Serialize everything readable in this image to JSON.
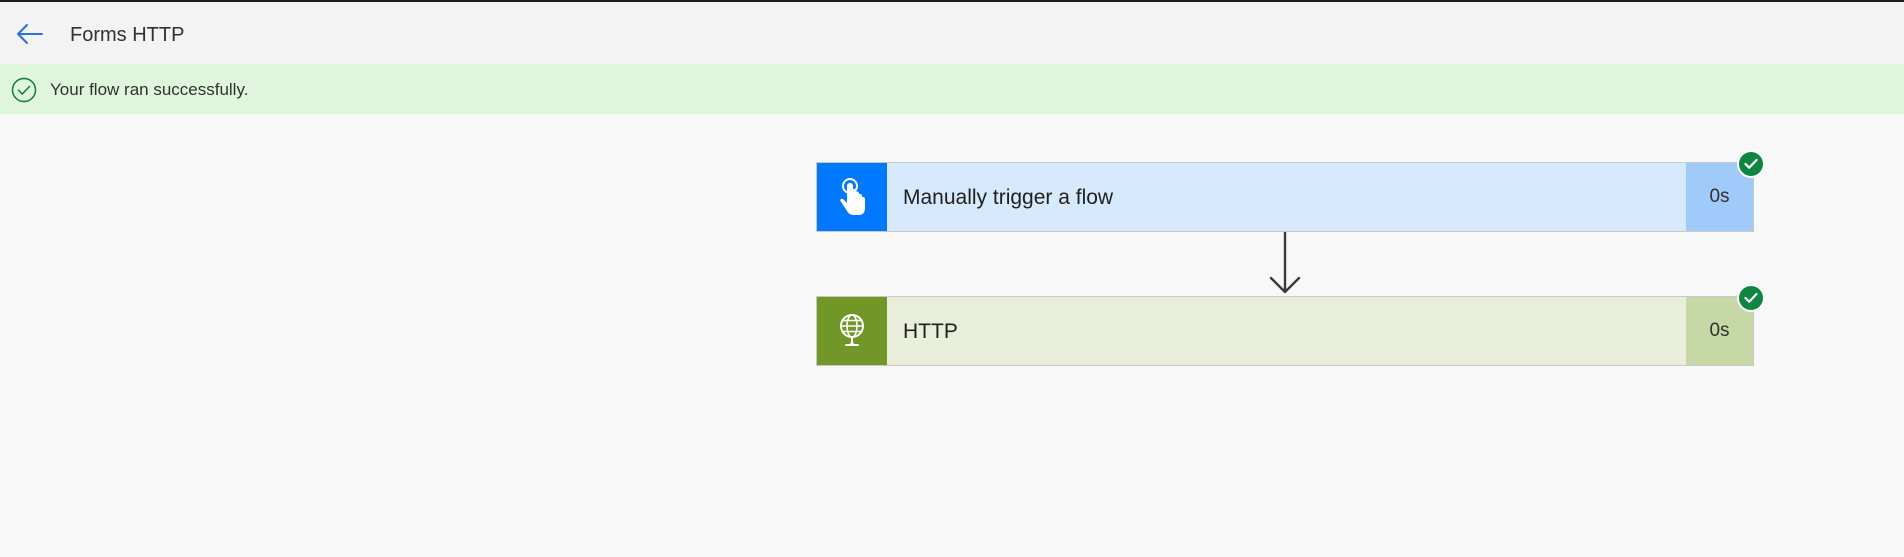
{
  "header": {
    "back_icon": "arrow-left-icon",
    "title": "Forms HTTP"
  },
  "banner": {
    "icon": "check-circle-icon",
    "message": "Your flow ran successfully.",
    "color": "#dff6dd"
  },
  "flow": {
    "steps": [
      {
        "label": "Manually trigger a flow",
        "duration": "0s",
        "icon": "hand-pointer-icon",
        "status": "succeeded",
        "accent": "#0078ff"
      },
      {
        "label": "HTTP",
        "duration": "0s",
        "icon": "globe-icon",
        "status": "succeeded",
        "accent": "#709727"
      }
    ],
    "connector_icon": "arrow-down-icon"
  }
}
